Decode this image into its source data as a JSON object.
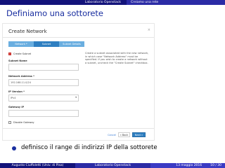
{
  "header": {
    "section": "Laboratorio Openstack",
    "subsection": "Creiamo una rete"
  },
  "frame_title": "Definiamo una sottorete",
  "dialog": {
    "title": "Create Network",
    "close": "×",
    "wizard_steps": [
      "Network *",
      "Subnet",
      "Subnet Details"
    ],
    "create_subnet_label": "Create Subnet",
    "subnet_name_label": "Subnet Name",
    "subnet_name_value": "",
    "network_address_label": "Network Address *",
    "network_address_value": "192.168.11.0/24",
    "ip_version_label": "IP Version *",
    "ip_version_value": "IPv4",
    "gateway_ip_label": "Gateway IP",
    "gateway_ip_value": "",
    "disable_gateway_label": "Disable Gateway",
    "description": "Create a subnet associated with the new network, in which case \"Network Address\" must be specified. If you wish to create a network without a subnet, uncheck the \"Create Subnet\" checkbox.",
    "buttons": {
      "cancel": "Cancel",
      "back": "« Back",
      "next": "Next »"
    }
  },
  "bullet": "definisco il range di indirizzi IP della sottorete",
  "footer": {
    "author": "Augusto Ciuffoletti (Univ. di Pisa)",
    "title": "Laboratorio Openstack",
    "date": "13 maggio 2016",
    "page": "10 / 30"
  },
  "colors": {
    "beamer_dark": "#13137a",
    "beamer_mid": "#2b2ba5",
    "title_blue": "#1a2fa0",
    "primary_button": "#2f7fc1"
  }
}
